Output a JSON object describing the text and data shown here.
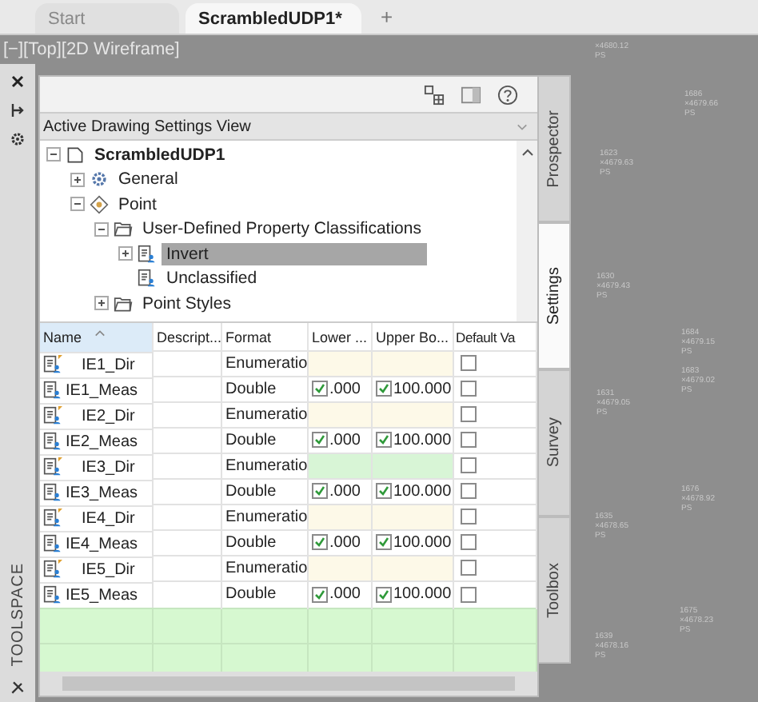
{
  "document_tabs": [
    {
      "label": "Start",
      "selected": false
    },
    {
      "label": "ScrambledUDP1*",
      "selected": true
    }
  ],
  "new_tab": "+",
  "viewport": {
    "label": "[−][Top][2D Wireframe]",
    "points": [
      {
        "elevation": "×4680.12",
        "code": "PS"
      },
      {
        "number": "1686",
        "elevation": "×4679.66",
        "code": "PS"
      },
      {
        "number": "1623",
        "elevation": "×4679.63",
        "code": "PS"
      },
      {
        "number": "1630",
        "elevation": "×4679.43",
        "code": "PS"
      },
      {
        "number": "1684",
        "elevation": "×4679.15",
        "code": "PS"
      },
      {
        "number": "1683",
        "elevation": "×4679.02",
        "code": "PS"
      },
      {
        "number": "1631",
        "elevation": "×4679.05",
        "code": "PS"
      },
      {
        "number": "1676",
        "elevation": "×4678.92",
        "code": "PS"
      },
      {
        "number": "1635",
        "elevation": "×4678.65",
        "code": "PS"
      },
      {
        "number": "1675",
        "elevation": "×4678.23",
        "code": "PS"
      },
      {
        "number": "1639",
        "elevation": "×4678.16",
        "code": "PS"
      }
    ]
  },
  "toolspace": {
    "title": "TOOLSPACE",
    "view_selector": "Active Drawing Settings View",
    "tabs": [
      {
        "label": "Prospector",
        "selected": false
      },
      {
        "label": "Settings",
        "selected": true
      },
      {
        "label": "Survey",
        "selected": false
      },
      {
        "label": "Toolbox",
        "selected": false
      }
    ],
    "tree": [
      {
        "label": "ScrambledUDP1",
        "kind": "drawing",
        "expanded": true,
        "selected": false,
        "children": [
          {
            "label": "General",
            "kind": "gear",
            "expanded": false,
            "selected": false
          },
          {
            "label": "Point",
            "kind": "point",
            "expanded": true,
            "selected": false,
            "children": [
              {
                "label": "User-Defined Property Classifications",
                "kind": "folder",
                "expanded": true,
                "selected": false,
                "children": [
                  {
                    "label": "Invert",
                    "kind": "property",
                    "expanded": false,
                    "selected": true
                  },
                  {
                    "label": "Unclassified",
                    "kind": "property",
                    "selected": false
                  }
                ]
              },
              {
                "label": "Point Styles",
                "kind": "folder",
                "expanded": false,
                "selected": false
              }
            ]
          }
        ]
      }
    ],
    "table": {
      "columns": [
        "Name",
        "Descript...",
        "Format",
        "Lower ...",
        "Upper Bo...",
        "Default Va"
      ],
      "rows": [
        {
          "name": "IE1_Dir",
          "kind": "enum",
          "format": "Enumeratio",
          "color": "#fdf9e8",
          "default_checked": false
        },
        {
          "name": "IE1_Meas",
          "kind": "number",
          "format": "Double",
          "lower": {
            "checked": true,
            "value": ".000"
          },
          "upper": {
            "checked": true,
            "value": "100.000"
          },
          "default_checked": false
        },
        {
          "name": "IE2_Dir",
          "kind": "enum",
          "format": "Enumeratio",
          "color": "#fdf9e8",
          "default_checked": false
        },
        {
          "name": "IE2_Meas",
          "kind": "number",
          "format": "Double",
          "lower": {
            "checked": true,
            "value": ".000"
          },
          "upper": {
            "checked": true,
            "value": "100.000"
          },
          "default_checked": false
        },
        {
          "name": "IE3_Dir",
          "kind": "enum",
          "format": "Enumeratio",
          "color": "#d8f5d6",
          "default_checked": false
        },
        {
          "name": "IE3_Meas",
          "kind": "number",
          "format": "Double",
          "lower": {
            "checked": true,
            "value": ".000"
          },
          "upper": {
            "checked": true,
            "value": "100.000"
          },
          "default_checked": false
        },
        {
          "name": "IE4_Dir",
          "kind": "enum",
          "format": "Enumeratio",
          "color": "#fdf9e8",
          "default_checked": false
        },
        {
          "name": "IE4_Meas",
          "kind": "number",
          "format": "Double",
          "lower": {
            "checked": true,
            "value": ".000"
          },
          "upper": {
            "checked": true,
            "value": "100.000"
          },
          "default_checked": false
        },
        {
          "name": "IE5_Dir",
          "kind": "enum",
          "format": "Enumeratio",
          "color": "#fdf9e8",
          "default_checked": false
        },
        {
          "name": "IE5_Meas",
          "kind": "number",
          "format": "Double",
          "lower": {
            "checked": true,
            "value": ".000"
          },
          "upper": {
            "checked": true,
            "value": "100.000"
          },
          "default_checked": false
        },
        {
          "kind": "new"
        },
        {
          "kind": "new"
        }
      ]
    }
  }
}
